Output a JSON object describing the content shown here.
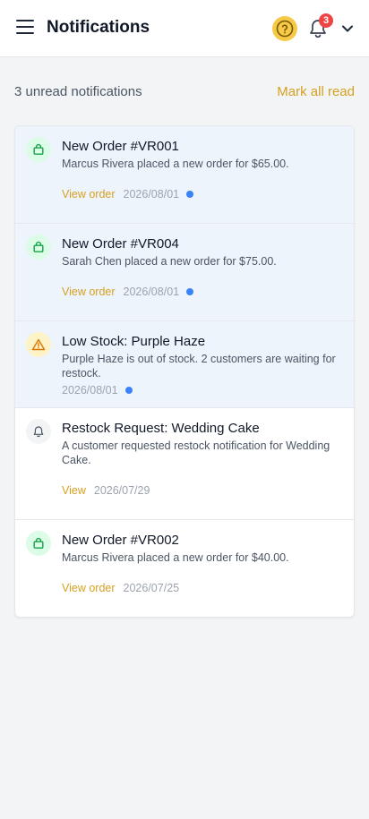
{
  "header": {
    "title": "Notifications",
    "menu_icon": "hamburger-icon",
    "help_icon": "help-circle-icon",
    "bell_icon": "bell-icon",
    "badge_count": "3",
    "account_icon": "chevron-down-icon"
  },
  "summary": {
    "unread_text": "3 unread notifications",
    "mark_all_label": "Mark all read"
  },
  "colors": {
    "accent": "#d6a020",
    "unread_bg": "#eef4fc",
    "unread_dot": "#3b82f6",
    "badge": "#ef4444"
  },
  "notifications": [
    {
      "icon": "shopping-bag-icon",
      "title": "New Order #VR001",
      "desc": "Marcus Rivera placed a new order for $65.00.",
      "link": "View order",
      "date": "2026/08/01",
      "unread": true
    },
    {
      "icon": "shopping-bag-icon",
      "title": "New Order #VR004",
      "desc": "Sarah Chen placed a new order for $75.00.",
      "link": "View order",
      "date": "2026/08/01",
      "unread": true
    },
    {
      "icon": "warning-icon",
      "title": "Low Stock: Purple Haze",
      "desc": "Purple Haze is out of stock. 2 customers are waiting for restock.",
      "link": "",
      "date": "2026/08/01",
      "unread": true
    },
    {
      "icon": "bell-icon",
      "title": "Restock Request: Wedding Cake",
      "desc": "A customer requested restock notification for Wedding Cake.",
      "link": "View",
      "date": "2026/07/29",
      "unread": false
    },
    {
      "icon": "shopping-bag-icon",
      "title": "New Order #VR002",
      "desc": "Marcus Rivera placed a new order for $40.00.",
      "link": "View order",
      "date": "2026/07/25",
      "unread": false
    }
  ]
}
